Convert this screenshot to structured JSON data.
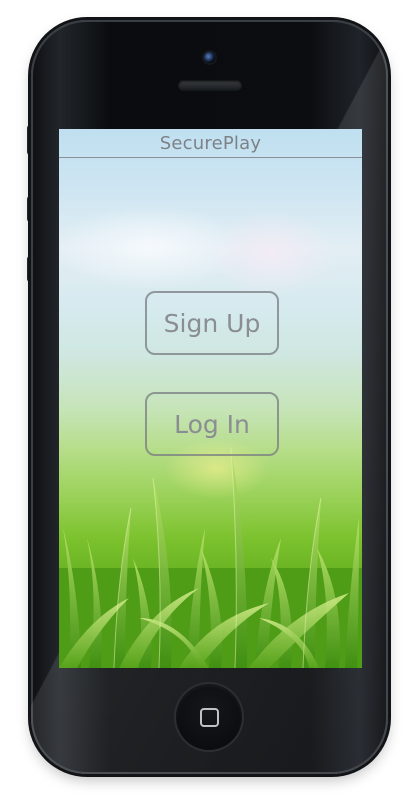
{
  "app": {
    "title": "SecurePlay"
  },
  "auth": {
    "signup_label": "Sign Up",
    "login_label": "Log In"
  },
  "theme": {
    "phone_color": "#0b0d10",
    "button_border": "#7a7e84",
    "button_text": "#8a8e93",
    "header_text": "#7d8288",
    "grass_green": "#62ad1e"
  },
  "icons": {
    "front_camera": "camera-icon",
    "speaker": "speaker-grille-icon",
    "home": "home-button-icon"
  }
}
